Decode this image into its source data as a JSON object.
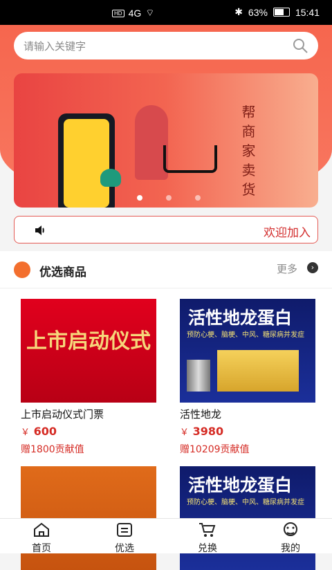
{
  "status": {
    "battery": "63%",
    "time": "15:41",
    "signal": "4G"
  },
  "search": {
    "placeholder": "请输入关键字",
    "icon": "search-icon"
  },
  "banner": {
    "text": "帮商家卖货",
    "dots": 3,
    "active_dot": 0,
    "colors": {
      "primary": "#e94442",
      "accent": "#ffd02f"
    }
  },
  "notice": {
    "text": "欢迎加入",
    "icon": "speaker-icon"
  },
  "section": {
    "title": "优选商品",
    "more": "更多",
    "icon": "diamond-icon"
  },
  "products": [
    {
      "image_title": "上市启动仪式",
      "name": "上市启动仪式门票",
      "price": "600",
      "gift": "赠1800贡献值"
    },
    {
      "image_title": "活性地龙蛋白",
      "image_sub": "预防心梗、脑梗、中风、糖尿病并发症",
      "name": "活性地龙",
      "price": "3980",
      "gift": "赠10209贡献值"
    },
    {
      "image_title": "",
      "name": "",
      "price": "",
      "gift": ""
    },
    {
      "image_title": "活性地龙蛋白",
      "image_sub": "预防心梗、脑梗、中风、糖尿病并发症",
      "name": "",
      "price": "",
      "gift": ""
    }
  ],
  "currency": "￥",
  "tabs": [
    {
      "label": "首页",
      "icon": "home-icon"
    },
    {
      "label": "优选",
      "icon": "list-icon"
    },
    {
      "label": "兑换",
      "icon": "cart-icon"
    },
    {
      "label": "我的",
      "icon": "user-icon"
    }
  ]
}
